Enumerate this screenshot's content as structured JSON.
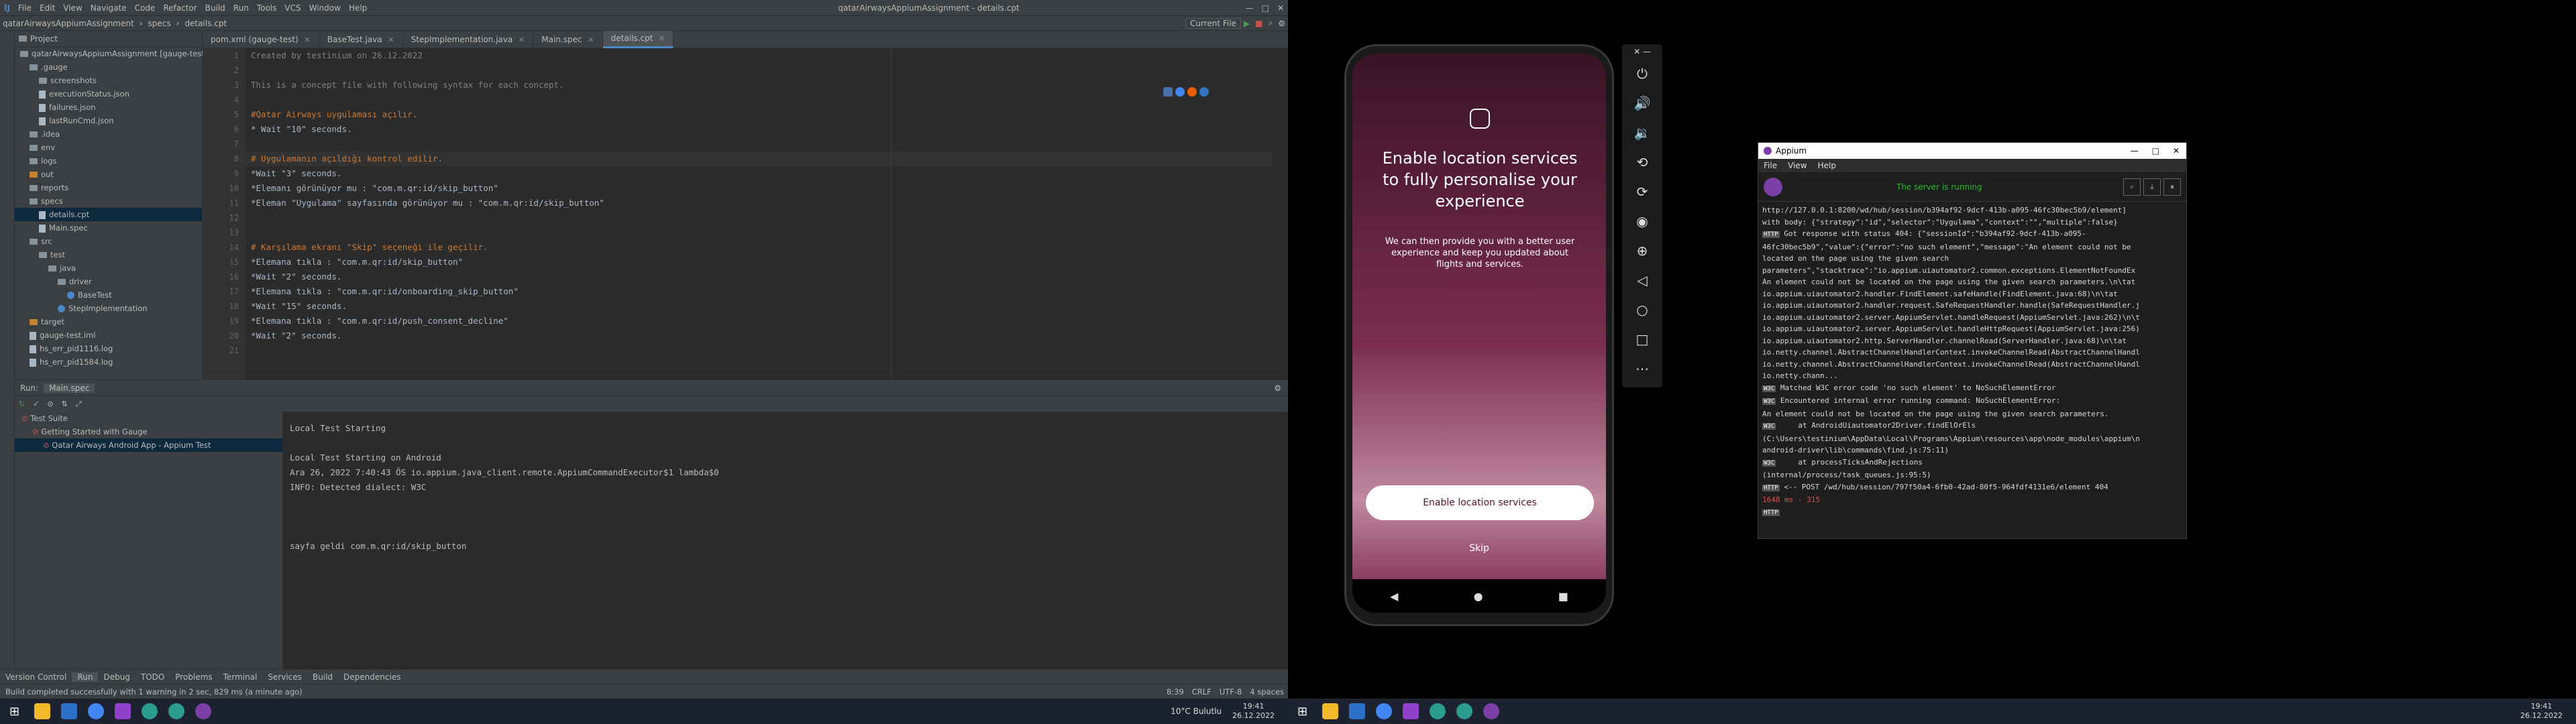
{
  "ide": {
    "menu": [
      "File",
      "Edit",
      "View",
      "Navigate",
      "Code",
      "Refactor",
      "Build",
      "Run",
      "Tools",
      "VCS",
      "Window",
      "Help"
    ],
    "window_title": "qatarAirwaysAppiumAssignment - details.cpt",
    "breadcrumb": [
      "qatarAirwaysAppiumAssignment",
      "specs",
      "details.cpt"
    ],
    "run_config": "Current File",
    "project_header": "Project",
    "tree": [
      {
        "label": "qatarAirwaysAppiumAssignment [gauge-test]",
        "indent": 0,
        "type": "folder"
      },
      {
        "label": ".gauge",
        "indent": 1,
        "type": "folder"
      },
      {
        "label": "screenshots",
        "indent": 2,
        "type": "folder"
      },
      {
        "label": "executionStatus.json",
        "indent": 2,
        "type": "file"
      },
      {
        "label": "failures.json",
        "indent": 2,
        "type": "file"
      },
      {
        "label": "lastRunCmd.json",
        "indent": 2,
        "type": "file"
      },
      {
        "label": ".idea",
        "indent": 1,
        "type": "folder"
      },
      {
        "label": "env",
        "indent": 1,
        "type": "folder"
      },
      {
        "label": "logs",
        "indent": 1,
        "type": "folder"
      },
      {
        "label": "out",
        "indent": 1,
        "type": "folder-o"
      },
      {
        "label": "reports",
        "indent": 1,
        "type": "folder"
      },
      {
        "label": "specs",
        "indent": 1,
        "type": "folder"
      },
      {
        "label": "details.cpt",
        "indent": 2,
        "type": "file",
        "selected": true
      },
      {
        "label": "Main.spec",
        "indent": 2,
        "type": "file"
      },
      {
        "label": "src",
        "indent": 1,
        "type": "folder"
      },
      {
        "label": "test",
        "indent": 2,
        "type": "folder"
      },
      {
        "label": "java",
        "indent": 3,
        "type": "folder"
      },
      {
        "label": "driver",
        "indent": 4,
        "type": "folder"
      },
      {
        "label": "BaseTest",
        "indent": 5,
        "type": "java"
      },
      {
        "label": "StepImplementation",
        "indent": 4,
        "type": "java"
      },
      {
        "label": "target",
        "indent": 1,
        "type": "folder-o"
      },
      {
        "label": "gauge-test.iml",
        "indent": 1,
        "type": "file"
      },
      {
        "label": "hs_err_pid1116.log",
        "indent": 1,
        "type": "file"
      },
      {
        "label": "hs_err_pid1584.log",
        "indent": 1,
        "type": "file"
      }
    ],
    "tabs": [
      "pom.xml (gauge-test)",
      "BaseTest.java",
      "StepImplementation.java",
      "Main.spec",
      "details.cpt"
    ],
    "active_tab_index": 4,
    "line_numbers": [
      "1",
      "2",
      "3",
      "4",
      "5",
      "6",
      "7",
      "8",
      "9",
      "10",
      "11",
      "12",
      "13",
      "14",
      "15",
      "16",
      "17",
      "18",
      "19",
      "20",
      "21"
    ],
    "code_lines": [
      {
        "t": "Created by testinium on 26.12.2022",
        "c": "cmt"
      },
      {
        "t": "",
        "c": "plain"
      },
      {
        "t": "This is a concept file with following syntax for each concept.",
        "c": "cmt"
      },
      {
        "t": "",
        "c": "plain"
      },
      {
        "t": "#Qatar Airways uygulaması açılır.",
        "c": "hd"
      },
      {
        "t": "* Wait \"10\" seconds.",
        "c": "plain"
      },
      {
        "t": "",
        "c": "plain"
      },
      {
        "t": "# Uygulamanın açıldığı kontrol edilir.",
        "c": "hd",
        "cur": true
      },
      {
        "t": "*Wait \"3\" seconds.",
        "c": "plain"
      },
      {
        "t": "*Elemanı görünüyor mu : \"com.m.qr:id/skip_button\"",
        "c": "plain"
      },
      {
        "t": "*Eleman \"Uygulama\" sayfasında görünüyor mu : \"com.m.qr:id/skip_button\"",
        "c": "plain"
      },
      {
        "t": "",
        "c": "plain"
      },
      {
        "t": "",
        "c": "plain"
      },
      {
        "t": "# Karşılama ekranı \"Skip\" seçeneği ile geçilir.",
        "c": "hd"
      },
      {
        "t": "*Elemana tıkla : \"com.m.qr:id/skip_button\"",
        "c": "plain"
      },
      {
        "t": "*Wait \"2\" seconds.",
        "c": "plain"
      },
      {
        "t": "*Elemana tıkla : \"com.m.qr:id/onboarding_skip_button\"",
        "c": "plain"
      },
      {
        "t": "*Wait \"15\" seconds.",
        "c": "plain"
      },
      {
        "t": "*Elemana tıkla : \"com.m.qr:id/push_consent_decline\"",
        "c": "plain"
      },
      {
        "t": "*Wait \"2\" seconds.",
        "c": "plain"
      },
      {
        "t": "",
        "c": "plain"
      }
    ],
    "run_header": "Run:",
    "run_tab": "Main.spec",
    "test_tree": [
      {
        "label": "Test Suite",
        "indent": 0
      },
      {
        "label": "Getting Started with Gauge",
        "indent": 1
      },
      {
        "label": "Qatar Airways Android App - Appium Test",
        "indent": 2,
        "selected": true
      }
    ],
    "console": [
      "Local Test Starting",
      "",
      "Local Test Starting on Android",
      "Ara 26, 2022 7:40:43 ÖS io.appium.java_client.remote.AppiumCommandExecutor$1 lambda$0",
      "INFO: Detected dialect: W3C",
      "",
      "",
      "",
      "sayfa geldi com.m.qr:id/skip_button"
    ],
    "bottom_tabs": [
      "Version Control",
      "Run",
      "Debug",
      "TODO",
      "Problems",
      "Terminal",
      "Services",
      "Build",
      "Dependencies"
    ],
    "status_text": "Build completed successfully with 1 warning in 2 sec, 829 ms (a minute ago)",
    "status_right": [
      "8:39",
      "CRLF",
      "UTF-8",
      "4 spaces"
    ]
  },
  "taskbar_left": {
    "weather": "10°C  Bulutlu",
    "time": "19:41",
    "date": "26.12.2022"
  },
  "taskbar_right": {
    "time": "19:41",
    "date": "26.12.2022"
  },
  "phone": {
    "title": "Enable location services to fully personalise your experience",
    "body": "We can then provide you with a better user experience and keep you updated about flights and services.",
    "primary_button": "Enable location services",
    "skip": "Skip"
  },
  "appium": {
    "title": "Appium",
    "menu": [
      "File",
      "View",
      "Help"
    ],
    "status": "The server is running",
    "log": [
      {
        "t": "http://127.0.0.1:8200/wd/hub/session/b394af92-9dcf-413b-a095-46fc30bec5b9/element]"
      },
      {
        "t": "with body: {\"strategy\":\"id\",\"selector\":\"Uygulama\",\"context\":\"\",\"multiple\":false}"
      },
      {
        "t": "Got response with status 404: {\"sessionId\":\"b394af92-9dcf-413b-a095-",
        "badge": "HTTP"
      },
      {
        "t": "46fc30bec5b9\",\"value\":{\"error\":\"no such element\",\"message\":\"An element could not be"
      },
      {
        "t": "located on the page using the given search"
      },
      {
        "t": "parameters\",\"stacktrace\":\"io.appium.uiautomator2.common.exceptions.ElementNotFoundEx"
      },
      {
        "t": "An element could not be located on the page using the given search parameters.\\n\\tat"
      },
      {
        "t": "io.appium.uiautomator2.handler.FindElement.safeHandle(FindElement.java:68)\\n\\tat"
      },
      {
        "t": "io.appium.uiautomator2.handler.request.SafeRequestHandler.handle(SafeRequestHandler.j"
      },
      {
        "t": "io.appium.uiautomator2.server.AppiumServlet.handleRequest(AppiumServlet.java:262)\\n\\t"
      },
      {
        "t": "io.appium.uiautomator2.server.AppiumServlet.handleHttpRequest(AppiumServlet.java:256)"
      },
      {
        "t": "io.appium.uiautomator2.http.ServerHandler.channelRead(ServerHandler.java:68)\\n\\tat"
      },
      {
        "t": "io.netty.channel.AbstractChannelHandlerContext.invokeChannelRead(AbstractChannelHandl"
      },
      {
        "t": "io.netty.channel.AbstractChannelHandlerContext.invokeChannelRead(AbstractChannelHandl"
      },
      {
        "t": "io.netty.chann..."
      },
      {
        "t": "Matched W3C error code 'no such element' to NoSuchElementError",
        "badge": "W3C"
      },
      {
        "t": "Encountered internal error running command: NoSuchElementError:",
        "badge": "W3C"
      },
      {
        "t": "An element could not be located on the page using the given search parameters."
      },
      {
        "t": "    at AndroidUiautomator2Driver.findElOrEls",
        "badge": "W3C"
      },
      {
        "t": "(C:\\Users\\testinium\\AppData\\Local\\Programs\\Appium\\resources\\app\\node_modules\\appium\\n"
      },
      {
        "t": "android-driver\\lib\\commands\\find.js:75:11)"
      },
      {
        "t": "    at processTicksAndRejections",
        "badge": "W3C"
      },
      {
        "t": "(internal/process/task_queues.js:95:5)"
      },
      {
        "t": "<-- POST /wd/hub/session/797f50a4-6fb0-42ad-80f5-964fdf4131e6/element 404",
        "badge": "HTTP"
      },
      {
        "t": "1648 ms - 315",
        "red": true
      },
      {
        "t": "",
        "badge": "HTTP"
      }
    ]
  }
}
